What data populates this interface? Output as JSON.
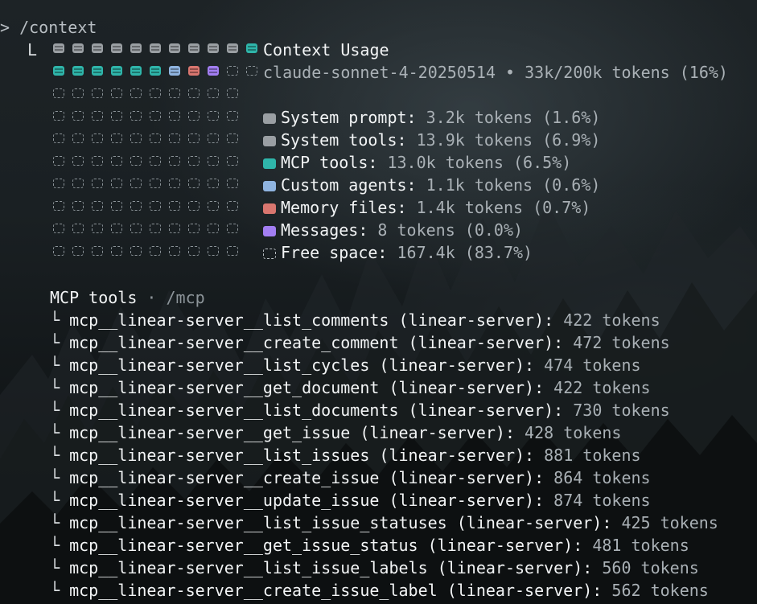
{
  "command": {
    "caret": ">",
    "text": "/context",
    "elbow": "L"
  },
  "usage": {
    "title": "Context Usage",
    "model_line": "claude-sonnet-4-20250514 • 33k/200k tokens (16%)"
  },
  "grid": {
    "rows": [
      [
        "sys",
        "tools",
        "tools",
        "tools",
        "tools",
        "tools",
        "tools",
        "tools",
        "tools",
        "tools",
        "mcp"
      ],
      [
        "mcp",
        "mcp",
        "mcp",
        "mcp",
        "mcp",
        "mcp",
        "agents",
        "memory",
        "msg",
        "free",
        "free"
      ],
      [
        "free",
        "free",
        "free",
        "free",
        "free",
        "free",
        "free",
        "free",
        "free",
        "free"
      ],
      [
        "free",
        "free",
        "free",
        "free",
        "free",
        "free",
        "free",
        "free",
        "free",
        "free"
      ],
      [
        "free",
        "free",
        "free",
        "free",
        "free",
        "free",
        "free",
        "free",
        "free",
        "free"
      ],
      [
        "free",
        "free",
        "free",
        "free",
        "free",
        "free",
        "free",
        "free",
        "free",
        "free"
      ],
      [
        "free",
        "free",
        "free",
        "free",
        "free",
        "free",
        "free",
        "free",
        "free",
        "free"
      ],
      [
        "free",
        "free",
        "free",
        "free",
        "free",
        "free",
        "free",
        "free",
        "free",
        "free"
      ],
      [
        "free",
        "free",
        "free",
        "free",
        "free",
        "free",
        "free",
        "free",
        "free",
        "free"
      ],
      [
        "free",
        "free",
        "free",
        "free",
        "free",
        "free",
        "free",
        "free",
        "free",
        "free"
      ]
    ]
  },
  "legend": [
    {
      "key": "sys",
      "label": "System prompt:",
      "value": "3.2k tokens (1.6%)",
      "color": "#9a9fa3",
      "icon": "system-prompt-icon"
    },
    {
      "key": "tools",
      "label": "System tools:",
      "value": "13.9k tokens (6.9%)",
      "color": "#9a9fa3",
      "icon": "system-tools-icon"
    },
    {
      "key": "mcp",
      "label": "MCP tools:",
      "value": "13.0k tokens (6.5%)",
      "color": "#2fb5aa",
      "icon": "mcp-tools-icon"
    },
    {
      "key": "agents",
      "label": "Custom agents:",
      "value": "1.1k tokens (0.6%)",
      "color": "#8fb4e0",
      "icon": "custom-agents-icon"
    },
    {
      "key": "memory",
      "label": "Memory files:",
      "value": "1.4k tokens (0.7%)",
      "color": "#d9766f",
      "icon": "memory-files-icon"
    },
    {
      "key": "msg",
      "label": "Messages:",
      "value": "8 tokens (0.0%)",
      "color": "#a27ef2",
      "icon": "messages-icon"
    },
    {
      "key": "free",
      "label": "Free space:",
      "value": "167.4k (83.7%)",
      "color": "#b8bec3",
      "icon": "free-space-icon"
    }
  ],
  "mcp_section": {
    "title": "MCP tools",
    "sep": " · ",
    "command": "/mcp",
    "branch": "└",
    "tools": [
      {
        "name": "mcp__linear-server__list_comments (linear-server):",
        "tokens": "422 tokens"
      },
      {
        "name": "mcp__linear-server__create_comment (linear-server):",
        "tokens": "472 tokens"
      },
      {
        "name": "mcp__linear-server__list_cycles (linear-server):",
        "tokens": "474 tokens"
      },
      {
        "name": "mcp__linear-server__get_document (linear-server):",
        "tokens": "422 tokens"
      },
      {
        "name": "mcp__linear-server__list_documents (linear-server):",
        "tokens": "730 tokens"
      },
      {
        "name": "mcp__linear-server__get_issue (linear-server):",
        "tokens": "428 tokens"
      },
      {
        "name": "mcp__linear-server__list_issues (linear-server):",
        "tokens": "881 tokens"
      },
      {
        "name": "mcp__linear-server__create_issue (linear-server):",
        "tokens": "864 tokens"
      },
      {
        "name": "mcp__linear-server__update_issue (linear-server):",
        "tokens": "874 tokens"
      },
      {
        "name": "mcp__linear-server__list_issue_statuses (linear-server):",
        "tokens": "425 tokens"
      },
      {
        "name": "mcp__linear-server__get_issue_status (linear-server):",
        "tokens": "481 tokens"
      },
      {
        "name": "mcp__linear-server__list_issue_labels (linear-server):",
        "tokens": "560 tokens"
      },
      {
        "name": "mcp__linear-server__create_issue_label (linear-server):",
        "tokens": "562 tokens"
      }
    ]
  }
}
